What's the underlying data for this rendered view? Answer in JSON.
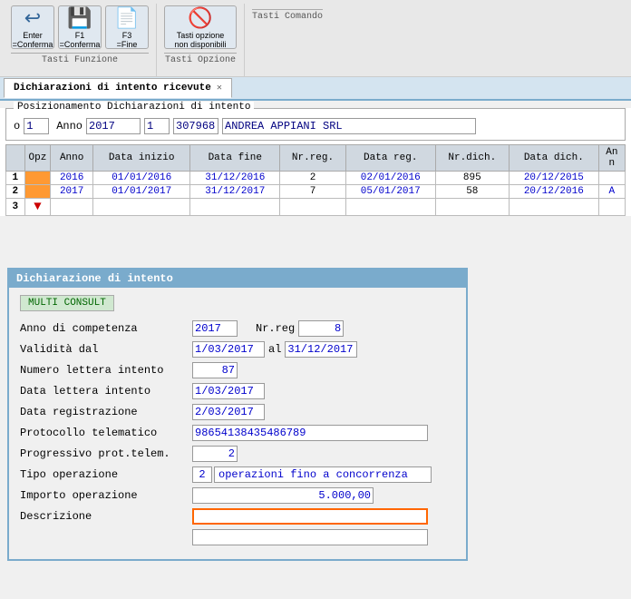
{
  "toolbar": {
    "groups": [
      {
        "label": "Tasti Funzione",
        "buttons": [
          {
            "id": "enter-btn",
            "icon": "↩",
            "line1": "Enter",
            "line2": "=Conferma"
          },
          {
            "id": "f1-btn",
            "icon": "💾",
            "line1": "F1",
            "line2": "=Conferma"
          },
          {
            "id": "f3-btn",
            "icon": "📄",
            "line1": "F3",
            "line2": "=Fine"
          }
        ]
      },
      {
        "label": "Tasti Opzione",
        "buttons": [
          {
            "id": "tasti-opzione-btn",
            "icon": "🚫",
            "line1": "Tasti opzione",
            "line2": "non disponibili"
          }
        ]
      },
      {
        "label": "Tasti Comando",
        "buttons": []
      }
    ]
  },
  "tab": {
    "label": "Dichiarazioni di intento ricevute",
    "close": "✕"
  },
  "positioning": {
    "section_title": "Posizionamento Dichiarazioni di intento",
    "o_label": "o",
    "field1": "1",
    "anno_label": "Anno",
    "anno_value": "2017",
    "field2": "1",
    "code": "307968",
    "name": "ANDREA APPIANI SRL"
  },
  "table": {
    "headers": [
      "Opz",
      "Anno",
      "Data inizio",
      "Data fine",
      "Nr.reg.",
      "Data reg.",
      "Nr.dich.",
      "Data dich.",
      "An\nn"
    ],
    "rows": [
      {
        "num": "1",
        "opz": "",
        "anno": "2016",
        "data_inizio": "01/01/2016",
        "data_fine": "31/12/2016",
        "nr_reg": "2",
        "data_reg": "02/01/2016",
        "nr_dich": "895",
        "data_dich": "20/12/2015",
        "ann": ""
      },
      {
        "num": "2",
        "opz": "",
        "anno": "2017",
        "data_inizio": "01/01/2017",
        "data_fine": "31/12/2017",
        "nr_reg": "7",
        "data_reg": "05/01/2017",
        "nr_dich": "58",
        "data_dich": "20/12/2016",
        "ann": "A"
      },
      {
        "num": "3",
        "opz": "▼",
        "anno": "",
        "data_inizio": "",
        "data_fine": "",
        "nr_reg": "",
        "data_reg": "",
        "nr_dich": "",
        "data_dich": "",
        "ann": ""
      }
    ]
  },
  "dialog": {
    "title": "Dichiarazione di intento",
    "badge": "MULTI CONSULT",
    "anno_competenza_label": "Anno di competenza",
    "anno_competenza_value": "2017",
    "nr_reg_label": "Nr.reg",
    "nr_reg_value": "8",
    "validita_label": "Validità dal",
    "validita_dal": "1/03/2017",
    "al_label": "al",
    "validita_al": "31/12/2017",
    "numero_lettera_label": "Numero lettera intento",
    "numero_lettera_value": "87",
    "data_lettera_label": "Data   lettera intento",
    "data_lettera_value": "1/03/2017",
    "data_registrazione_label": "Data  registrazione",
    "data_registrazione_value": "2/03/2017",
    "protocollo_label": "Protocollo telematico",
    "protocollo_value": "98654138435486789",
    "progressivo_label": "Progressivo prot.telem.",
    "progressivo_value": "2",
    "tipo_label": "Tipo   operazione",
    "tipo_num": "2",
    "tipo_desc": "operazioni fino a concorrenza",
    "importo_label": "Importo operazione",
    "importo_value": "5.000,00",
    "descrizione_label": "Descrizione",
    "descrizione_value": "",
    "descrizione_value2": ""
  }
}
